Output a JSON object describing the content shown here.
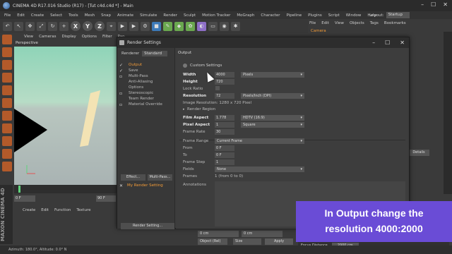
{
  "title": "CINEMA 4D R17.016 Studio (R17) - [Tut c4d.c4d *] - Main",
  "menu": [
    "File",
    "Edit",
    "Create",
    "Select",
    "Tools",
    "Mesh",
    "Snap",
    "Animate",
    "Simulate",
    "Render",
    "Sculpt",
    "Motion Tracker",
    "MoGraph",
    "Character",
    "Pipeline",
    "Plugins",
    "Script",
    "Window",
    "Help"
  ],
  "layout_label": "Layout:",
  "layout_value": "Startup",
  "toolbar": {
    "x": "X",
    "y": "Y",
    "z": "Z"
  },
  "viewport": {
    "menu": [
      "View",
      "Cameras",
      "Display",
      "Options",
      "Filter",
      "Pan"
    ],
    "label": "Perspective"
  },
  "timeline": {
    "start": "0 F",
    "end": "90 F"
  },
  "material_menu": [
    "Create",
    "Edit",
    "Function",
    "Texture"
  ],
  "maxon": "MAXON CINEMA 4D",
  "status": "Azimuth: 180.0°, Altitude: 0.0°  N",
  "right_panel": {
    "menu": [
      "File",
      "Edit",
      "View",
      "Objects",
      "Tags",
      "Bookmarks"
    ],
    "camera": "Camera",
    "details": "Details"
  },
  "coords": {
    "c1": "0 cm",
    "c2": "0 cm",
    "object_sel": "Object (Rel)",
    "size_sel": "Size",
    "apply": "Apply"
  },
  "focus": {
    "label": "Focus Distance",
    "value": "2000 cm"
  },
  "dialog": {
    "title": "Render Settings",
    "renderer_label": "Renderer",
    "renderer_value": "Standard",
    "nav": [
      "Output",
      "Save",
      "Multi-Pass",
      "Anti-Aliasing",
      "Options",
      "Stereoscopic",
      "Team Render",
      "Material Override"
    ],
    "effect_btn": "Effect...",
    "multipass_btn": "Multi-Pass...",
    "my_render_setting": "My Render Setting",
    "render_setting_btn": "Render Setting...",
    "section": "Output",
    "custom_settings": "Custom Settings",
    "width_label": "Width",
    "width_value": "4000",
    "width_unit": "Pixels",
    "height_label": "Height",
    "height_value": "720",
    "lock_ratio": "Lock Ratio",
    "resolution_label": "Resolution",
    "resolution_value": "72",
    "resolution_unit": "Pixels/Inch (DPI)",
    "image_resolution": "Image Resolution: 1280 x 720 Pixel",
    "render_region": "Render Region",
    "film_aspect_label": "Film Aspect",
    "film_aspect_value": "1.778",
    "film_aspect_sel": "HDTV (16:9)",
    "pixel_aspect_label": "Pixel Aspect",
    "pixel_aspect_value": "1",
    "pixel_aspect_sel": "Square",
    "frame_rate_label": "Frame Rate",
    "frame_rate_value": "30",
    "frame_range_label": "Frame Range",
    "frame_range_value": "Current Frame",
    "from_label": "From",
    "from_value": "0 F",
    "to_label": "To",
    "to_value": "0 F",
    "frame_step_label": "Frame Step",
    "frame_step_value": "1",
    "fields_label": "Fields",
    "fields_value": "None",
    "frames_label": "Frames",
    "frames_value": "1 (from 0 to 0)",
    "annotations_label": "Annotations"
  },
  "caption": {
    "line1": "In  Output change the",
    "line2": "resolution 4000:2000",
    "bg": "#6a4cd6"
  }
}
